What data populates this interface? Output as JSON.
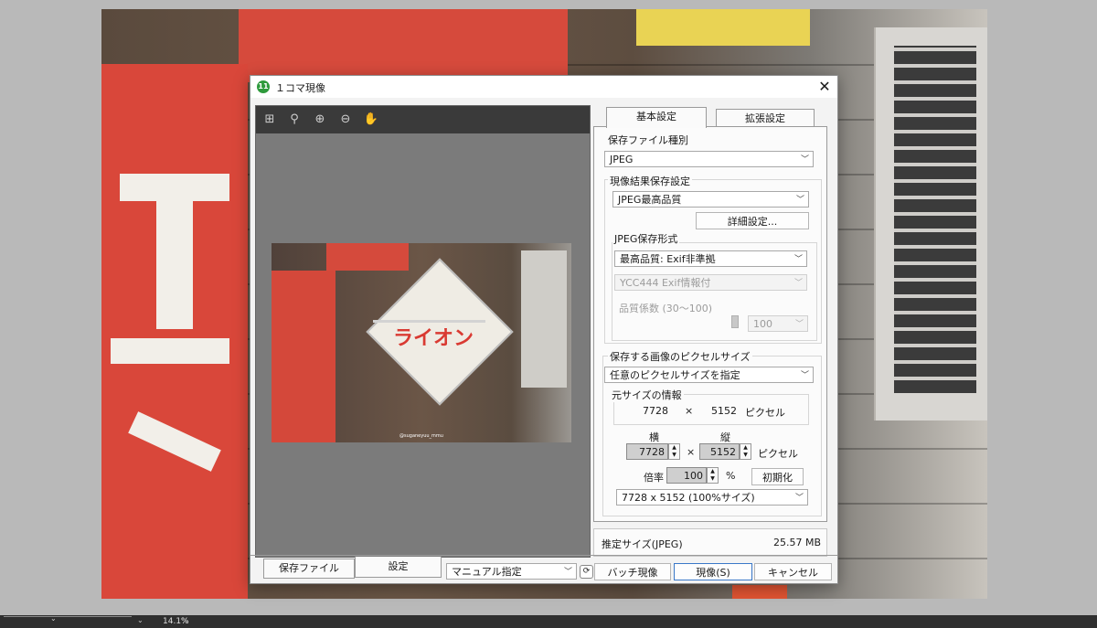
{
  "dialog": {
    "title": "１コマ現像",
    "app_icon_text": "11",
    "close": "✕"
  },
  "preview": {
    "tools": [
      "grid-icon",
      "zoom-icon",
      "zoom-in-icon",
      "zoom-out-icon",
      "hand-icon"
    ],
    "image_text": "ライオン",
    "watermark": "@suganeyuu_mmu"
  },
  "tabs": {
    "basic": "基本設定",
    "extended": "拡張設定"
  },
  "settings": {
    "file_type_label": "保存ファイル種別",
    "file_type_value": "JPEG",
    "result_group_label": "現像結果保存設定",
    "quality_value": "JPEG最高品質",
    "detail_button": "詳細設定...",
    "jpeg_format_label": "JPEG保存形式",
    "jpeg_format_value": "最高品質: Exif非準拠",
    "ycc_value": "YCC444 Exif情報付",
    "quality_factor_label": "品質係数 (30～100)",
    "quality_factor_value": "100",
    "pixel_size_label": "保存する画像のピクセルサイズ",
    "pixel_size_value": "任意のピクセルサイズを指定",
    "original_size_label": "元サイズの情報",
    "orig_w": "7728",
    "times": "×",
    "orig_h": "5152",
    "pixel_unit": "ピクセル",
    "width_label": "横",
    "height_label": "縦",
    "width_value": "7728",
    "height_value": "5152",
    "scale_label": "倍率",
    "scale_value": "100",
    "percent": "%",
    "reset_button": "初期化",
    "preset_value": "7728 x  5152  (100%サイズ)"
  },
  "estimate": {
    "label": "推定サイズ(JPEG)",
    "value": "25.57 MB"
  },
  "bottom": {
    "tab_save_file": "保存ファイル",
    "tab_settings": "設定",
    "mode_value": "マニュアル指定",
    "batch_button": "バッチ現像",
    "develop_button": "現像(S)",
    "cancel_button": "キャンセル"
  },
  "statusbar": {
    "zoom_value": "14.1",
    "zoom_unit": "%"
  }
}
